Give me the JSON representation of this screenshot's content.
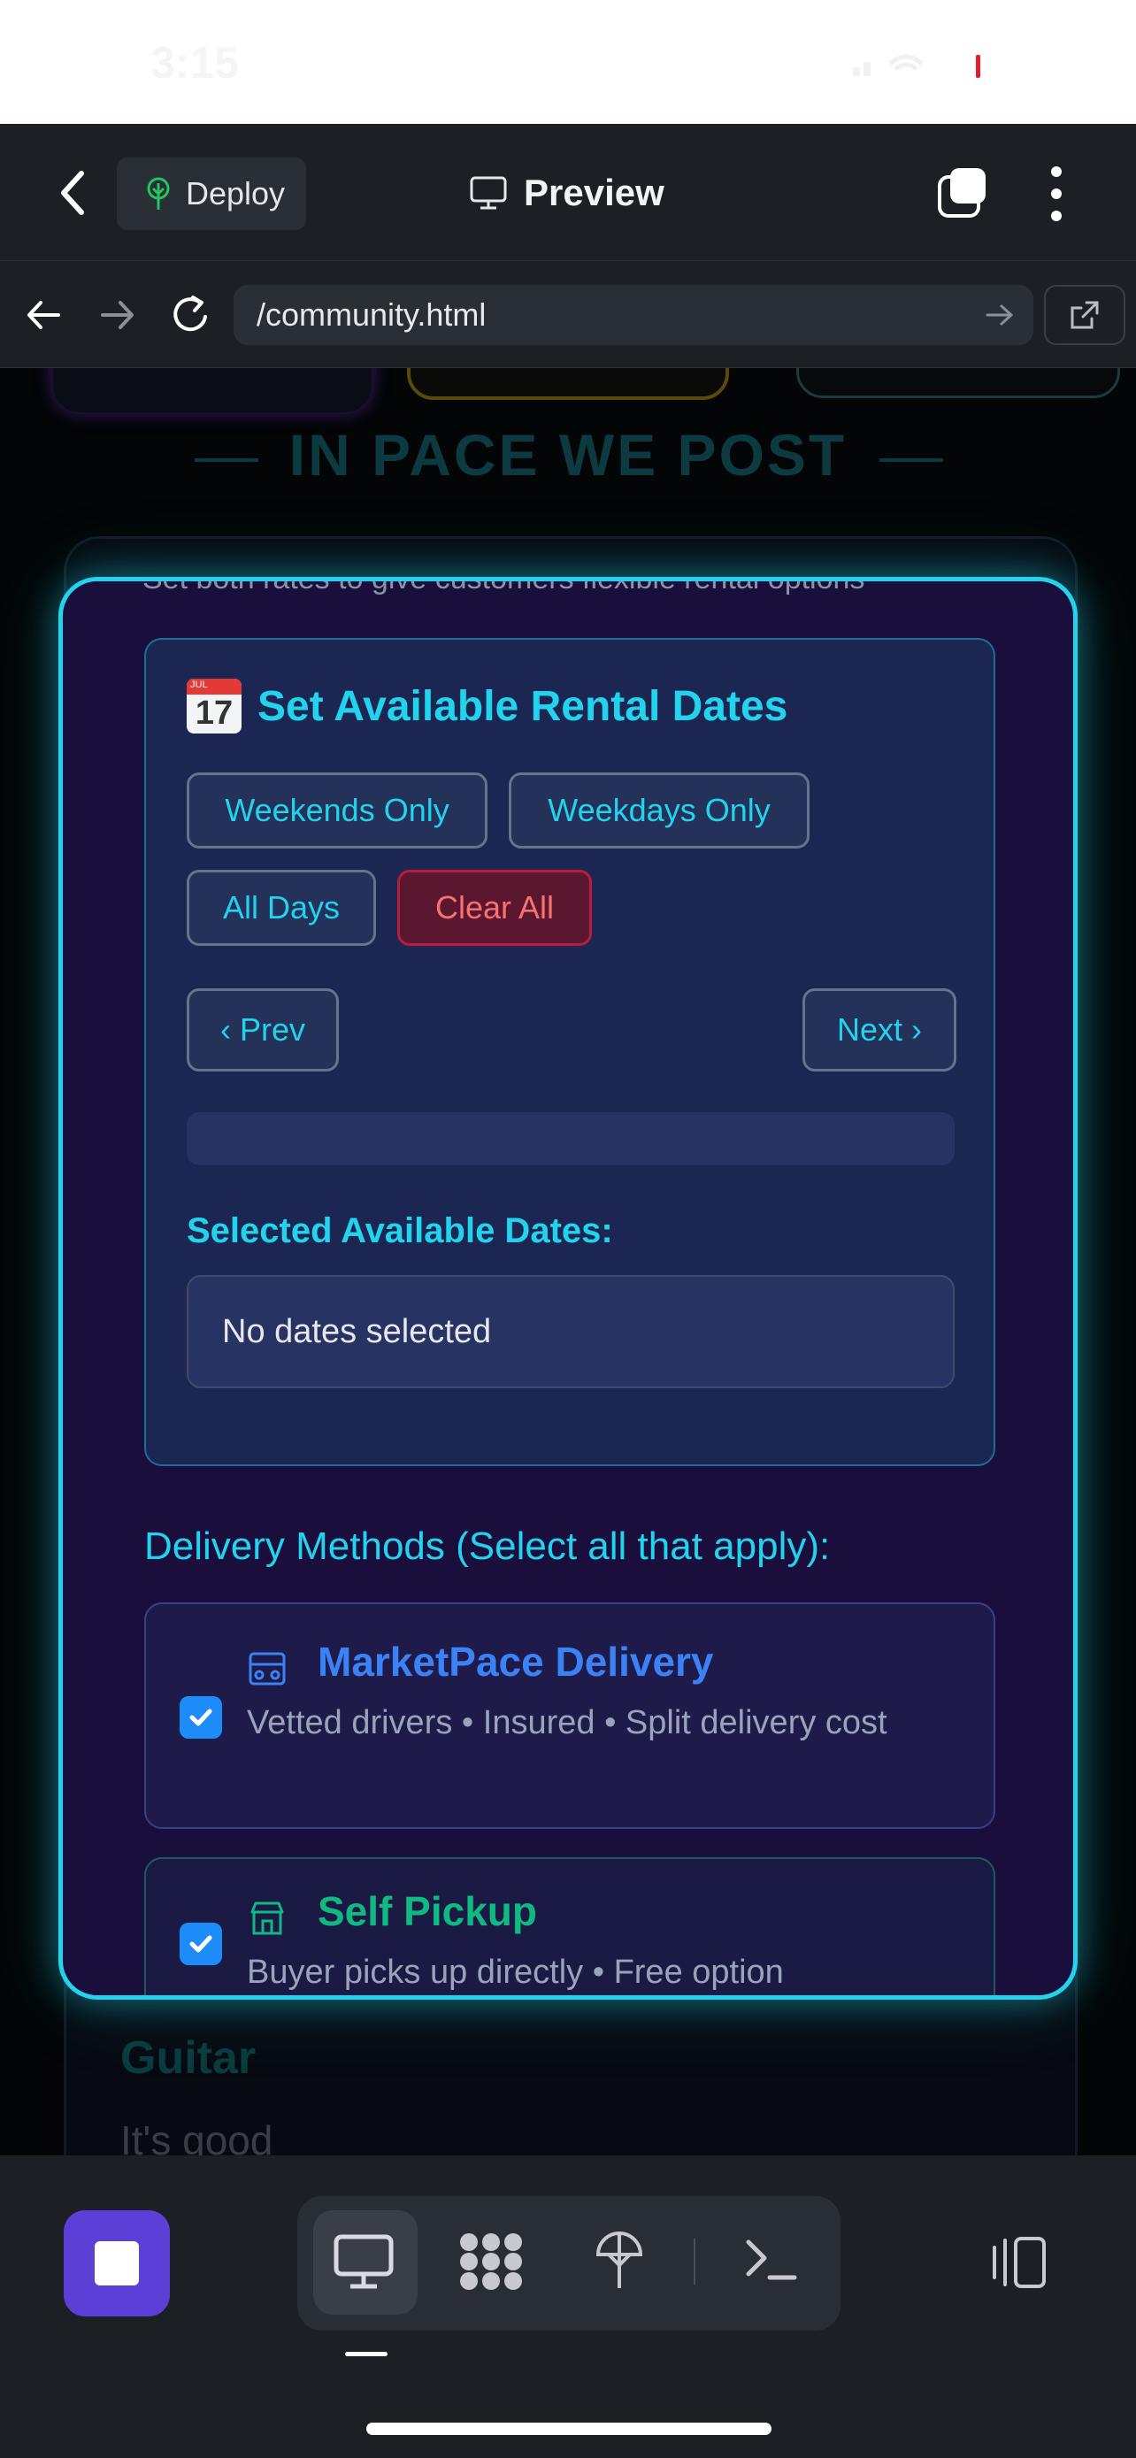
{
  "status_bar": {
    "time": "3:15"
  },
  "app_header": {
    "deploy_label": "Deploy",
    "preview_label": "Preview"
  },
  "browser": {
    "url": "/community.html"
  },
  "background_page": {
    "heading": "IN PACE WE POST",
    "listing_title": "Guitar",
    "listing_desc": "It's good"
  },
  "modal": {
    "cut_text": "Set both rates to give customers flexible rental options",
    "dates_title": "Set Available Rental Dates",
    "calendar_icon": {
      "month": "JUL",
      "day": "17"
    },
    "quick_buttons": [
      "Weekends Only",
      "Weekdays Only",
      "All Days",
      "Clear All"
    ],
    "prev_label": "‹ Prev",
    "next_label": "Next ›",
    "selected_label": "Selected Available Dates:",
    "selected_value": "No dates selected",
    "delivery_heading": "Delivery Methods (Select all that apply):",
    "delivery_options": [
      {
        "title": "MarketPace Delivery",
        "desc": "Vetted drivers • Insured • Split delivery cost",
        "checked": true,
        "color": "#3b82f6",
        "icon": "truck-icon"
      },
      {
        "title": "Self Pickup",
        "desc": "Buyer picks up directly • Free option",
        "checked": true,
        "color": "#10b981",
        "icon": "store-icon"
      }
    ]
  },
  "colors": {
    "accent": "#22d3ee",
    "danger": "#f87171",
    "stop": "#5b3fd6"
  }
}
